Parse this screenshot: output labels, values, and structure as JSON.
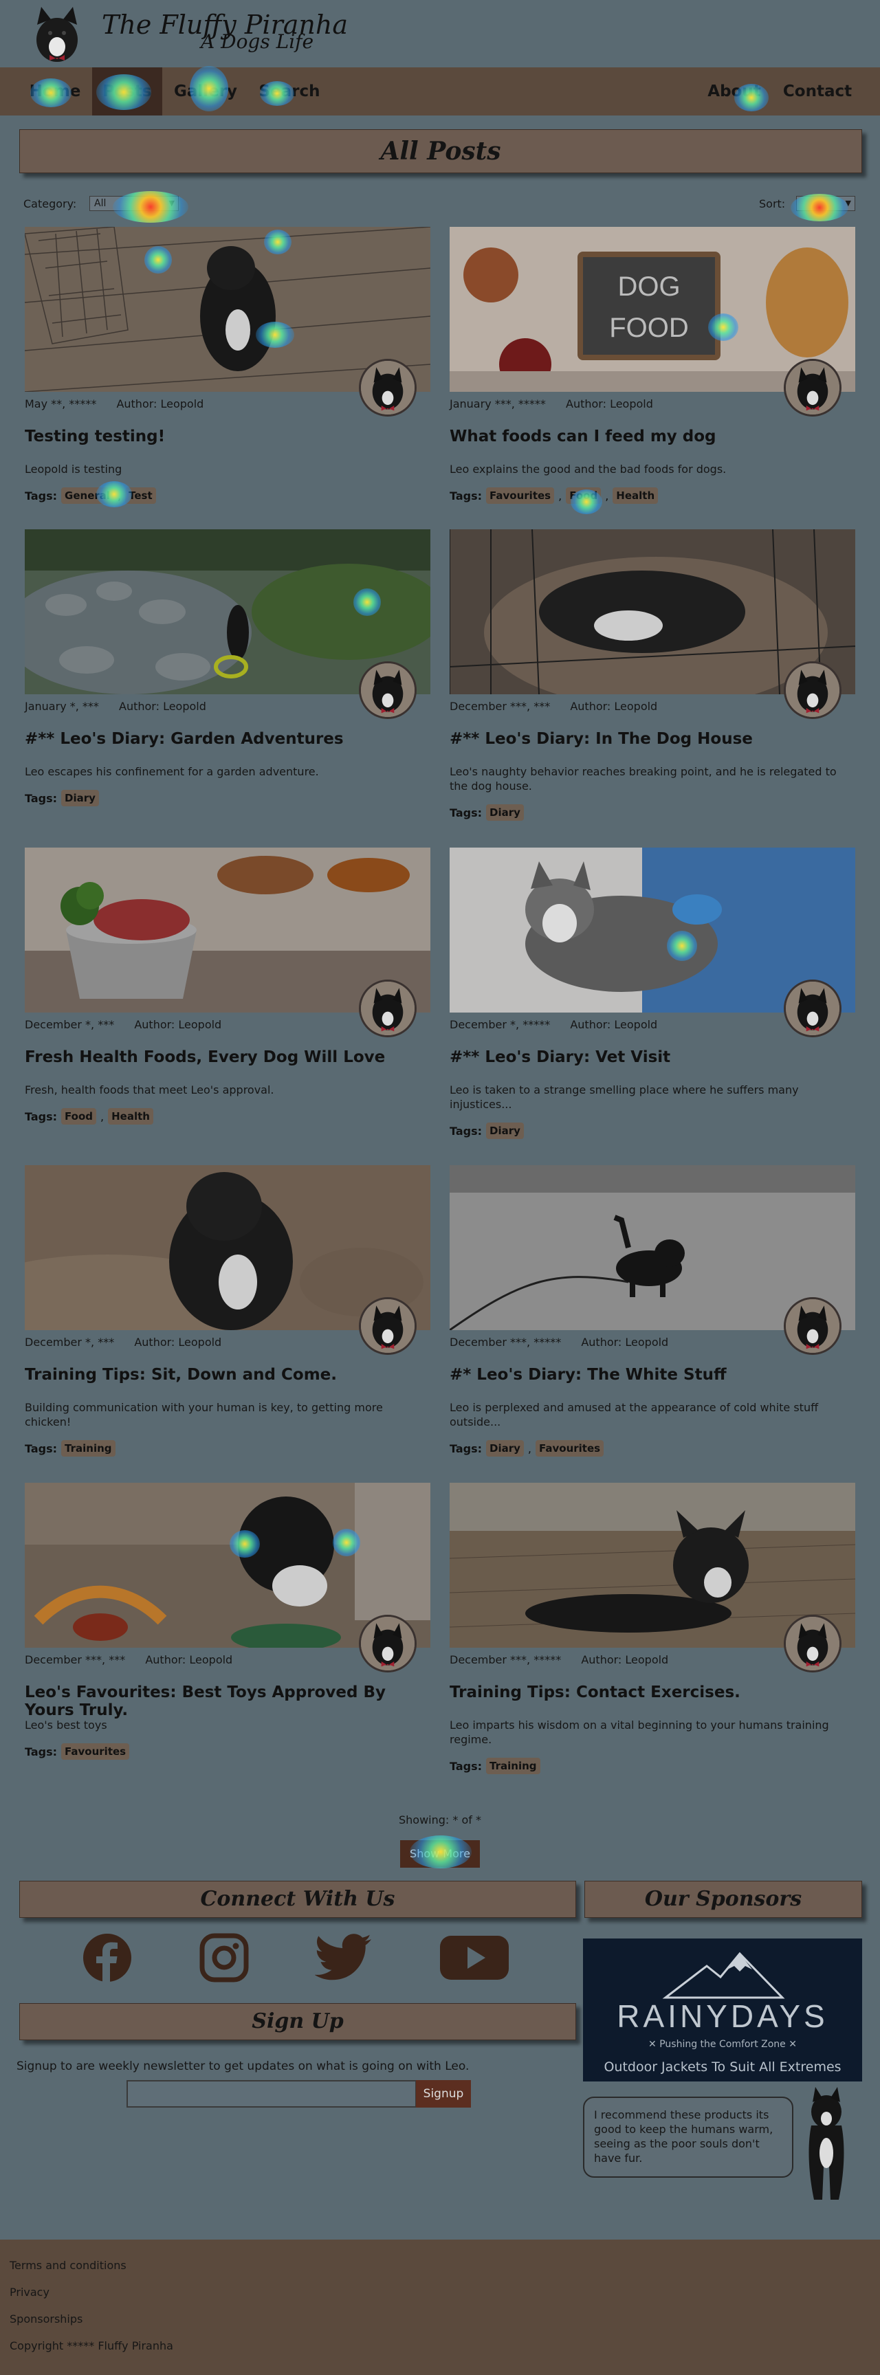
{
  "header": {
    "title": "The Fluffy Piranha",
    "tagline": "A Dogs Life",
    "logo_icon": "dog-logo-icon"
  },
  "nav": {
    "items": [
      {
        "label": "Home",
        "active": false
      },
      {
        "label": "Posts",
        "active": true
      },
      {
        "label": "Gallery",
        "active": false
      },
      {
        "label": "Search",
        "active": false
      },
      {
        "label": "About",
        "active": false
      },
      {
        "label": "Contact",
        "active": false
      }
    ]
  },
  "posts_heading": "All Posts",
  "filters": {
    "category_label": "Category:",
    "category_value": "All",
    "sort_label": "Sort:",
    "sort_value": ""
  },
  "posts": [
    {
      "date": "May **, *****",
      "author": "Author: Leopold",
      "title": "Testing testing!",
      "excerpt": "Leopold is testing",
      "tags_label": "Tags:",
      "tags": [
        "General",
        "Test"
      ],
      "image": "puppy-on-floor"
    },
    {
      "date": "January ***, *****",
      "author": "Author: Leopold",
      "title": "What foods can I feed my dog",
      "excerpt": "Leo explains the good and the bad foods for dogs.",
      "tags_label": "Tags:",
      "tags": [
        "Favourites",
        "Food",
        "Health"
      ],
      "image": "dog-food-board",
      "board_text_1": "DOG",
      "board_text_2": "FOOD"
    },
    {
      "date": "January *, ***",
      "author": "Author: Leopold",
      "title": "#** Leo's Diary: Garden Adventures",
      "excerpt": "Leo escapes his confinement for a garden adventure.",
      "tags_label": "Tags:",
      "tags": [
        "Diary"
      ],
      "image": "garden-rocks"
    },
    {
      "date": "December ***, ***",
      "author": "Author: Leopold",
      "title": "#** Leo's Diary: In The Dog House",
      "excerpt": "Leo's naughty behavior reaches breaking point, and he is relegated to the dog house.",
      "tags_label": "Tags:",
      "tags": [
        "Diary"
      ],
      "image": "dog-in-crate"
    },
    {
      "date": "December *, ***",
      "author": "Author: Leopold",
      "title": "Fresh Health Foods, Every Dog Will Love",
      "excerpt": "Fresh, health foods that meet Leo's approval.",
      "tags_label": "Tags:",
      "tags": [
        "Food",
        "Health"
      ],
      "image": "food-bowl"
    },
    {
      "date": "December *, *****",
      "author": "Author: Leopold",
      "title": "#** Leo's Diary: Vet Visit",
      "excerpt": "Leo is taken to a strange smelling place where he suffers many injustices...",
      "tags_label": "Tags:",
      "tags": [
        "Diary"
      ],
      "image": "vet-husky"
    },
    {
      "date": "December *, ***",
      "author": "Author: Leopold",
      "title": "Training Tips: Sit, Down and Come.",
      "excerpt": "Building communication with your human is key, to getting more chicken!",
      "tags_label": "Tags:",
      "tags": [
        "Training"
      ],
      "image": "puppy-on-rug"
    },
    {
      "date": "December ***, *****",
      "author": "Author: Leopold",
      "title": "#* Leo's Diary: The White Stuff",
      "excerpt": "Leo is perplexed and amused at the appearance of cold white stuff outside...",
      "tags_label": "Tags:",
      "tags": [
        "Diary",
        "Favourites"
      ],
      "image": "puppy-in-snow"
    },
    {
      "date": "December ***, ***",
      "author": "Author: Leopold",
      "title": "Leo's Favourites: Best Toys Approved By Yours Truly.",
      "excerpt": "Leo's best toys",
      "tags_label": "Tags:",
      "tags": [
        "Favourites"
      ],
      "image": "toys"
    },
    {
      "date": "December ***, *****",
      "author": "Author: Leopold",
      "title": "Training Tips: Contact Exercises.",
      "excerpt": "Leo imparts his wisdom on a vital beginning to your humans training regime.",
      "tags_label": "Tags:",
      "tags": [
        "Training"
      ],
      "image": "puppy-lying"
    }
  ],
  "pagination": {
    "showing": "Showing: * of *",
    "button": "Show More"
  },
  "connect": {
    "heading": "Connect With Us",
    "icons": [
      "facebook-icon",
      "instagram-icon",
      "twitter-icon",
      "youtube-icon"
    ]
  },
  "signup": {
    "heading": "Sign Up",
    "text": "Signup to are weekly newsletter to get updates on what is going on with Leo.",
    "placeholder": "",
    "button": "Signup"
  },
  "sponsors": {
    "heading": "Our Sponsors",
    "brand": "RAINYDAYS",
    "slogan": "✕ Pushing the Comfort Zone ✕",
    "subtitle": "Outdoor Jackets To Suit All Extremes",
    "quote": "I recommend these products its good to keep the humans warm, seeing as the poor souls don't have fur."
  },
  "footer": {
    "links": [
      "Terms and conditions",
      "Privacy",
      "Sponsorships"
    ],
    "copyright": "Copyright ***** Fluffy Piranha"
  },
  "colors": {
    "background": "#5a6a72",
    "nav": "#5b4a3d",
    "nav_active": "#3b2921",
    "tag": "#6d5e51",
    "button": "#4a2a1d"
  }
}
